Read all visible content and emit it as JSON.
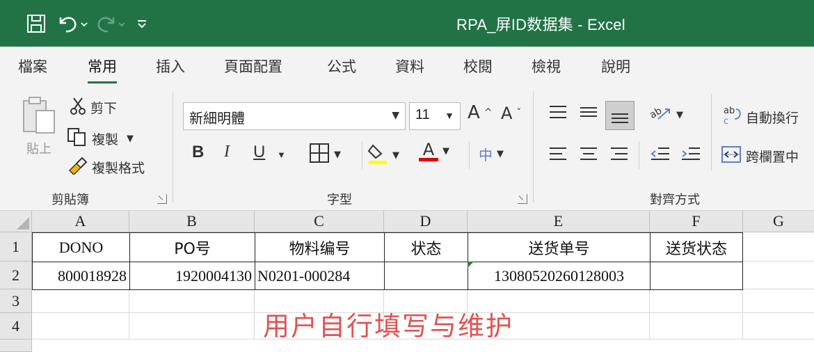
{
  "app": {
    "title": "RPA_屏ID数据集 - Excel",
    "accent_color": "#217346"
  },
  "qat": {
    "icons": [
      "save-icon",
      "undo-icon",
      "redo-icon",
      "customize-icon"
    ]
  },
  "tabs": [
    {
      "label": "檔案"
    },
    {
      "label": "常用",
      "active": true
    },
    {
      "label": "插入"
    },
    {
      "label": "頁面配置"
    },
    {
      "label": "公式"
    },
    {
      "label": "資料"
    },
    {
      "label": "校閱"
    },
    {
      "label": "檢視"
    },
    {
      "label": "說明"
    }
  ],
  "ribbon": {
    "clipboard": {
      "paste_label": "貼上",
      "cut_label": "剪下",
      "copy_label": "複製",
      "format_painter_label": "複製格式",
      "group_label": "剪貼簿"
    },
    "font": {
      "font_name": "新細明體",
      "font_size": "11",
      "bold": "B",
      "italic": "I",
      "underline": "U",
      "font_color_glyph": "A",
      "phonetic_glyph": "中",
      "grow_glyph": "A",
      "shrink_glyph": "A",
      "group_label": "字型"
    },
    "alignment": {
      "wrap_text_label": "自動換行",
      "merge_center_label": "跨欄置中",
      "group_label": "對齊方式"
    }
  },
  "sheet": {
    "columns": [
      "A",
      "B",
      "C",
      "D",
      "E",
      "F",
      "G"
    ],
    "rows": [
      "1",
      "2",
      "3",
      "4"
    ],
    "header_row": [
      "DONO",
      "PO号",
      "物料编号",
      "状态",
      "送货单号",
      "送货状态"
    ],
    "data_row": [
      "800018928",
      "1920004130",
      "N0201-000284",
      "",
      "13080520260128003",
      ""
    ],
    "note": "用户自行填写与维护",
    "note_color": "#e35252"
  }
}
